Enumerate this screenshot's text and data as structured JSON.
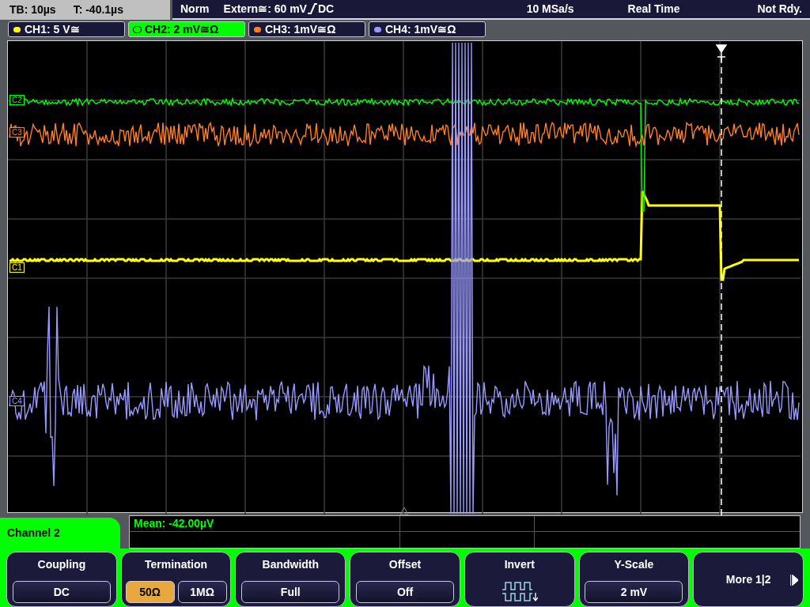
{
  "status_bar": {
    "timebase": "TB: 10µs",
    "trigger_time": "T: -40.1µs",
    "trigger_mode": "Norm",
    "trigger_source": "Extern≅: 60 mV",
    "trigger_coupling": "DC",
    "sample_rate": "10 MSa/s",
    "acquisition": "Real Time",
    "state": "Not Rdy."
  },
  "channels": [
    {
      "label": "CH1: 5 V≅",
      "color": "#ffff00",
      "selected": false
    },
    {
      "label": "CH2: 2 mV≅Ω",
      "color": "#00ff00",
      "selected": true
    },
    {
      "label": "CH3: 1mV≅Ω",
      "color": "#ff7f27",
      "selected": false
    },
    {
      "label": "CH4: 1mV≅Ω",
      "color": "#9999ff",
      "selected": false
    }
  ],
  "markers": [
    {
      "label": "C2",
      "color": "#00ff00"
    },
    {
      "label": "C3",
      "color": "#ff7f27"
    },
    {
      "label": "C1",
      "color": "#ffff00"
    },
    {
      "label": "C4",
      "color": "#9999ff"
    }
  ],
  "menu": {
    "title": "Channel 2",
    "softkeys": [
      {
        "kind": "value",
        "title": "Coupling",
        "value": "DC"
      },
      {
        "kind": "toggle",
        "title": "Termination",
        "options": [
          {
            "label": "50Ω",
            "selected": true
          },
          {
            "label": "1MΩ",
            "selected": false
          }
        ]
      },
      {
        "kind": "value",
        "title": "Bandwidth",
        "value": "Full"
      },
      {
        "kind": "value",
        "title": "Offset",
        "value": "Off"
      },
      {
        "kind": "icon",
        "title": "Invert"
      },
      {
        "kind": "value",
        "title": "Y-Scale",
        "value": "2 mV"
      },
      {
        "kind": "more",
        "title": "More 1|2"
      }
    ]
  },
  "measurement": {
    "text": "Mean: -42.00µV"
  }
}
